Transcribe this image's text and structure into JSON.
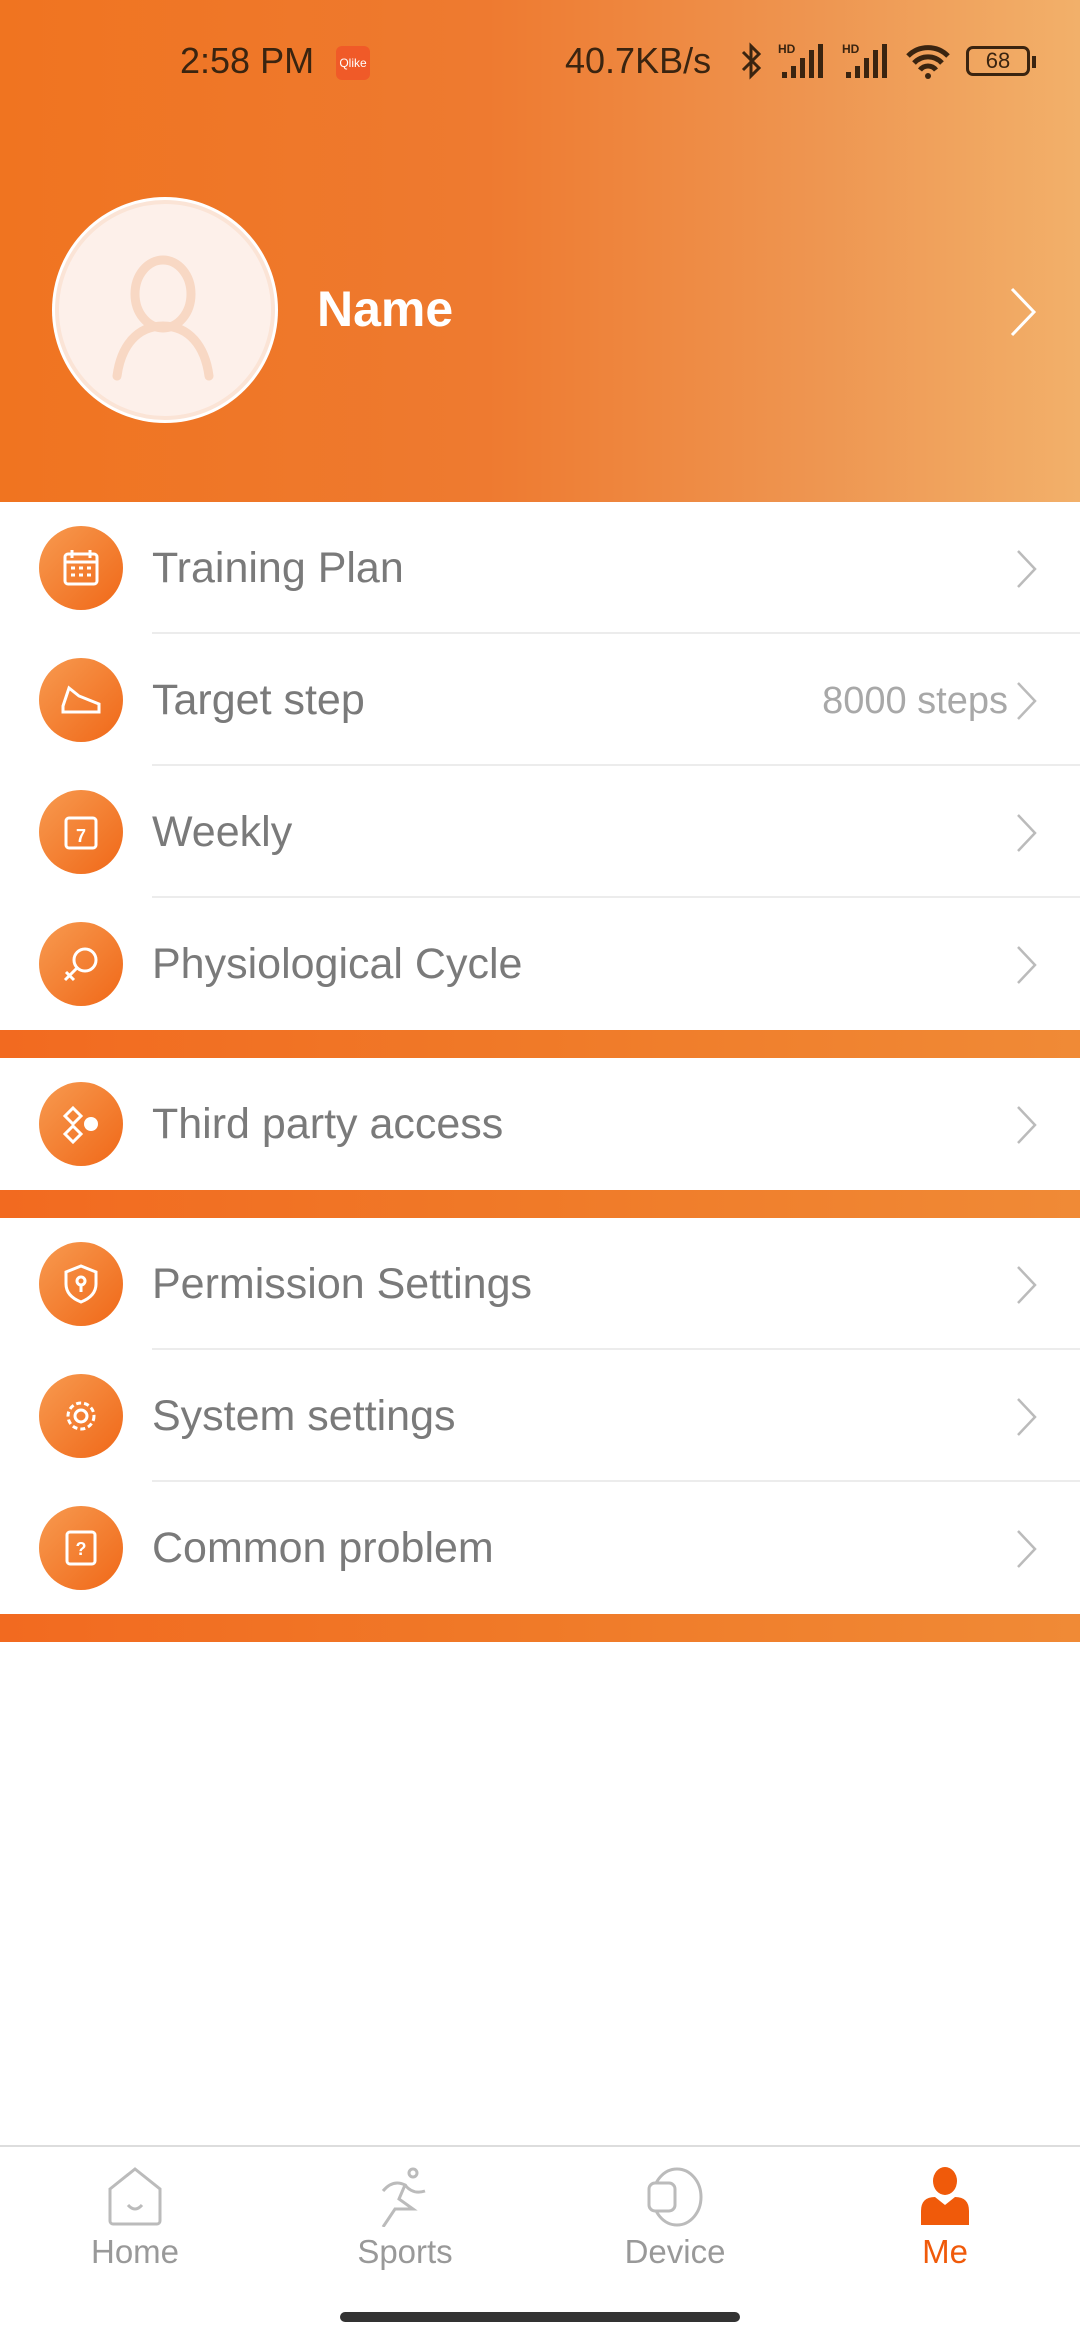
{
  "status_bar": {
    "time": "2:58 PM",
    "app_badge": "Qlike",
    "network_speed": "40.7KB/s",
    "battery": "68",
    "icons": [
      "bluetooth-icon",
      "signal-hd-icon",
      "signal-hd-icon",
      "wifi-icon",
      "battery-icon"
    ]
  },
  "profile": {
    "name": "Name",
    "avatar_icon": "user-icon"
  },
  "menu_groups": [
    [
      {
        "label": "Training Plan",
        "icon": "calendar-icon"
      },
      {
        "label": "Target step",
        "value": "8000 steps",
        "icon": "shoe-icon"
      },
      {
        "label": "Weekly",
        "icon": "weekly-calendar-icon"
      },
      {
        "label": "Physiological Cycle",
        "icon": "female-icon"
      }
    ],
    [
      {
        "label": "Third party access",
        "icon": "connect-icon"
      }
    ],
    [
      {
        "label": "Permission Settings",
        "icon": "shield-icon"
      },
      {
        "label": "System settings",
        "icon": "gear-icon"
      },
      {
        "label": "Common problem",
        "icon": "question-icon"
      }
    ]
  ],
  "tabs": [
    {
      "label": "Home",
      "icon": "home-icon"
    },
    {
      "label": "Sports",
      "icon": "running-icon"
    },
    {
      "label": "Device",
      "icon": "watch-icon"
    },
    {
      "label": "Me",
      "icon": "user-icon",
      "active": true
    }
  ],
  "colors": {
    "accent": "#f05a0a",
    "header_start": "#f07420",
    "header_end": "#f2b06a",
    "inactive": "#999999"
  }
}
